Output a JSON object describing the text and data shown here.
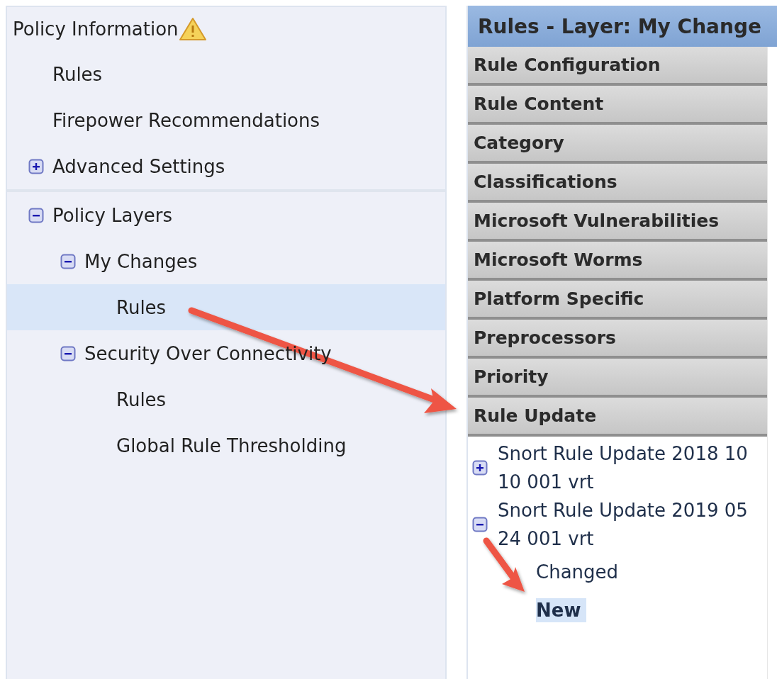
{
  "sidebar": {
    "header": {
      "label": "Policy Information",
      "warning": true
    },
    "sections": [
      {
        "items": [
          {
            "label": "Rules",
            "selected": false
          },
          {
            "label": "Firepower Recommendations",
            "selected": false
          },
          {
            "label": "Advanced Settings",
            "selected": false,
            "expanded": false
          }
        ]
      },
      {
        "items": [
          {
            "label": "Policy Layers",
            "selected": false,
            "expanded": true,
            "children": [
              {
                "label": "My Changes",
                "selected": false,
                "expanded": true,
                "children": [
                  {
                    "label": "Rules",
                    "selected": true
                  }
                ]
              },
              {
                "label": "Security Over Connectivity",
                "selected": false,
                "expanded": true,
                "children": [
                  {
                    "label": "Rules",
                    "selected": false
                  },
                  {
                    "label": "Global Rule Thresholding",
                    "selected": false
                  }
                ]
              }
            ]
          }
        ]
      }
    ]
  },
  "panel": {
    "title": "Rules - Layer: My Change",
    "sections": [
      {
        "label": "Rule Configuration"
      },
      {
        "label": "Rule Content"
      },
      {
        "label": "Category"
      },
      {
        "label": "Classifications"
      },
      {
        "label": "Microsoft Vulnerabilities"
      },
      {
        "label": "Microsoft Worms"
      },
      {
        "label": "Platform Specific"
      },
      {
        "label": "Preprocessors"
      },
      {
        "label": "Priority"
      },
      {
        "label": "Rule Update",
        "items": [
          {
            "label": "Snort Rule Update 2018 10 10 001 vrt",
            "selected": false,
            "expanded": false
          },
          {
            "label": "Snort Rule Update 2019 05 24 001 vrt",
            "selected": false,
            "expanded": true,
            "children": [
              {
                "label": "Changed",
                "selected": false
              },
              {
                "label": "New",
                "selected": true
              }
            ]
          }
        ]
      }
    ]
  }
}
